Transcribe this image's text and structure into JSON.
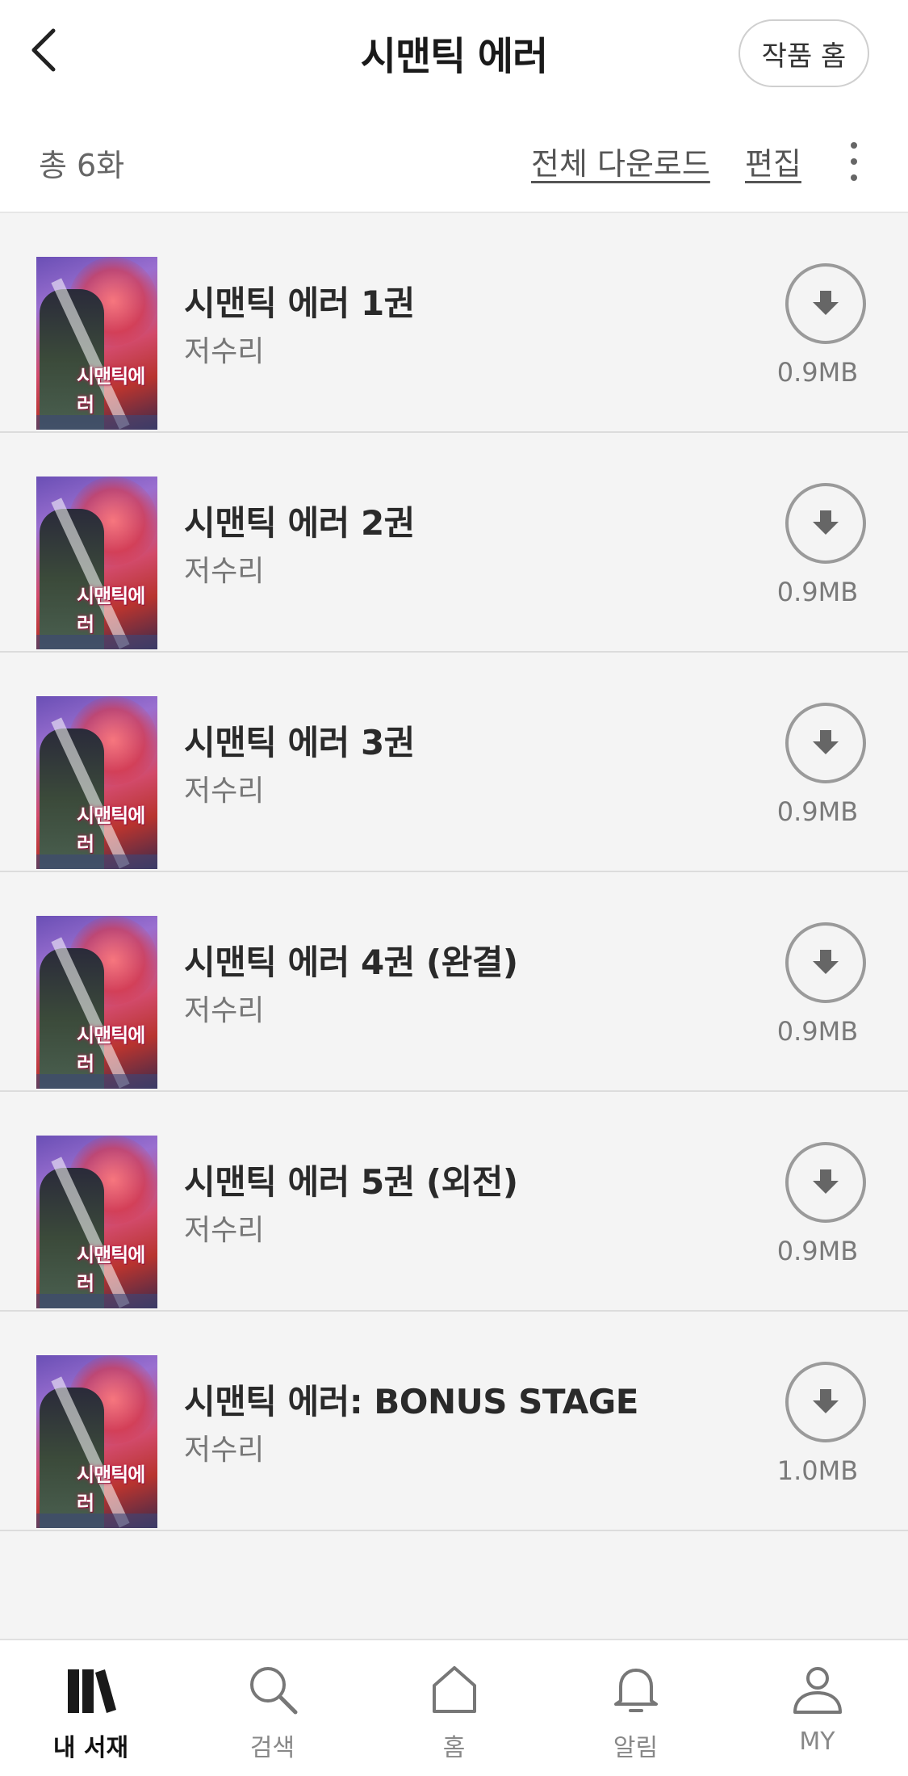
{
  "header": {
    "title": "시맨틱 에러",
    "home_button": "작품 홈"
  },
  "toolbar": {
    "count": "총 6화",
    "download_all": "전체 다운로드",
    "edit": "편집"
  },
  "episodes": [
    {
      "title": "시맨틱 에러 1권",
      "author": "저수리",
      "size": "0.9MB"
    },
    {
      "title": "시맨틱 에러 2권",
      "author": "저수리",
      "size": "0.9MB"
    },
    {
      "title": "시맨틱 에러 3권",
      "author": "저수리",
      "size": "0.9MB"
    },
    {
      "title": "시맨틱 에러 4권 (완결)",
      "author": "저수리",
      "size": "0.9MB"
    },
    {
      "title": "시맨틱 에러 5권 (외전)",
      "author": "저수리",
      "size": "0.9MB"
    },
    {
      "title": "시맨틱 에러: BONUS STAGE",
      "author": "저수리",
      "size": "1.0MB"
    }
  ],
  "cover_logo": "시맨틱에러",
  "bottom_nav": [
    {
      "label": "내 서재",
      "icon": "library-icon",
      "active": true
    },
    {
      "label": "검색",
      "icon": "search-icon",
      "active": false
    },
    {
      "label": "홈",
      "icon": "home-icon",
      "active": false
    },
    {
      "label": "알림",
      "icon": "bell-icon",
      "active": false
    },
    {
      "label": "MY",
      "icon": "person-icon",
      "active": false
    }
  ],
  "colors": {
    "background": "#f4f4f4",
    "active_nav": "#111111",
    "inactive_nav": "#888888"
  }
}
